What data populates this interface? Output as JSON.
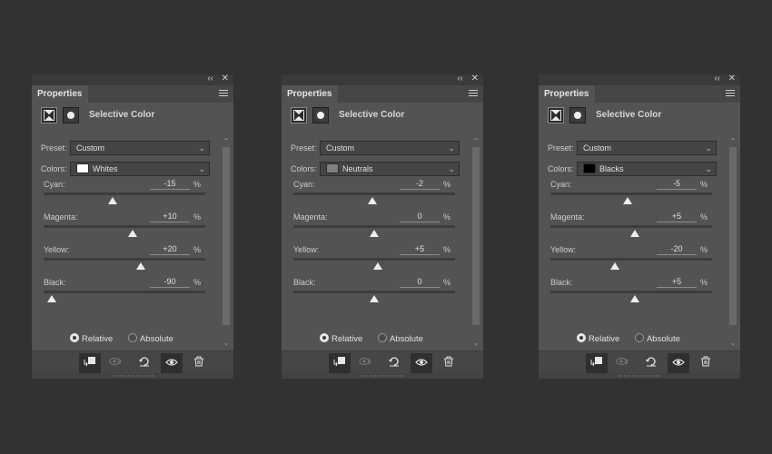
{
  "panels": [
    {
      "tab_label": "Properties",
      "title": "Selective Color",
      "preset_label": "Preset:",
      "preset_value": "Custom",
      "colors_label": "Colors:",
      "colors_value": "Whites",
      "swatch_color": "#ffffff",
      "sliders": [
        {
          "label": "Cyan:",
          "value": "-15",
          "unit": "%",
          "level": -15
        },
        {
          "label": "Magenta:",
          "value": "+10",
          "unit": "%",
          "level": 10
        },
        {
          "label": "Yellow:",
          "value": "+20",
          "unit": "%",
          "level": 20
        },
        {
          "label": "Black:",
          "value": "-90",
          "unit": "%",
          "level": -90
        }
      ],
      "method": {
        "relative": "Relative",
        "absolute": "Absolute",
        "selected": "Relative"
      }
    },
    {
      "tab_label": "Properties",
      "title": "Selective Color",
      "preset_label": "Preset:",
      "preset_value": "Custom",
      "colors_label": "Colors:",
      "colors_value": "Neutrals",
      "swatch_color": "#808080",
      "sliders": [
        {
          "label": "Cyan:",
          "value": "-2",
          "unit": "%",
          "level": -2
        },
        {
          "label": "Magenta:",
          "value": "0",
          "unit": "%",
          "level": 0
        },
        {
          "label": "Yellow:",
          "value": "+5",
          "unit": "%",
          "level": 5
        },
        {
          "label": "Black:",
          "value": "0",
          "unit": "%",
          "level": 0
        }
      ],
      "method": {
        "relative": "Relative",
        "absolute": "Absolute",
        "selected": "Relative"
      }
    },
    {
      "tab_label": "Properties",
      "title": "Selective Color",
      "preset_label": "Preset:",
      "preset_value": "Custom",
      "colors_label": "Colors:",
      "colors_value": "Blacks",
      "swatch_color": "#000000",
      "sliders": [
        {
          "label": "Cyan:",
          "value": "-5",
          "unit": "%",
          "level": -5
        },
        {
          "label": "Magenta:",
          "value": "+5",
          "unit": "%",
          "level": 5
        },
        {
          "label": "Yellow:",
          "value": "-20",
          "unit": "%",
          "level": -20
        },
        {
          "label": "Black:",
          "value": "+5",
          "unit": "%",
          "level": 5
        }
      ],
      "method": {
        "relative": "Relative",
        "absolute": "Absolute",
        "selected": "Relative"
      }
    }
  ],
  "icons": {
    "collapse": "double-chevron-left-icon",
    "close": "close-icon",
    "menu": "panel-menu-icon",
    "clip": "clip-to-layer-icon",
    "view_previous": "view-previous-state-icon",
    "reset": "reset-icon",
    "visibility": "eye-icon",
    "delete": "trash-icon"
  },
  "colors": {
    "background": "#323232",
    "panel": "#535353",
    "knob": "#ededed"
  }
}
